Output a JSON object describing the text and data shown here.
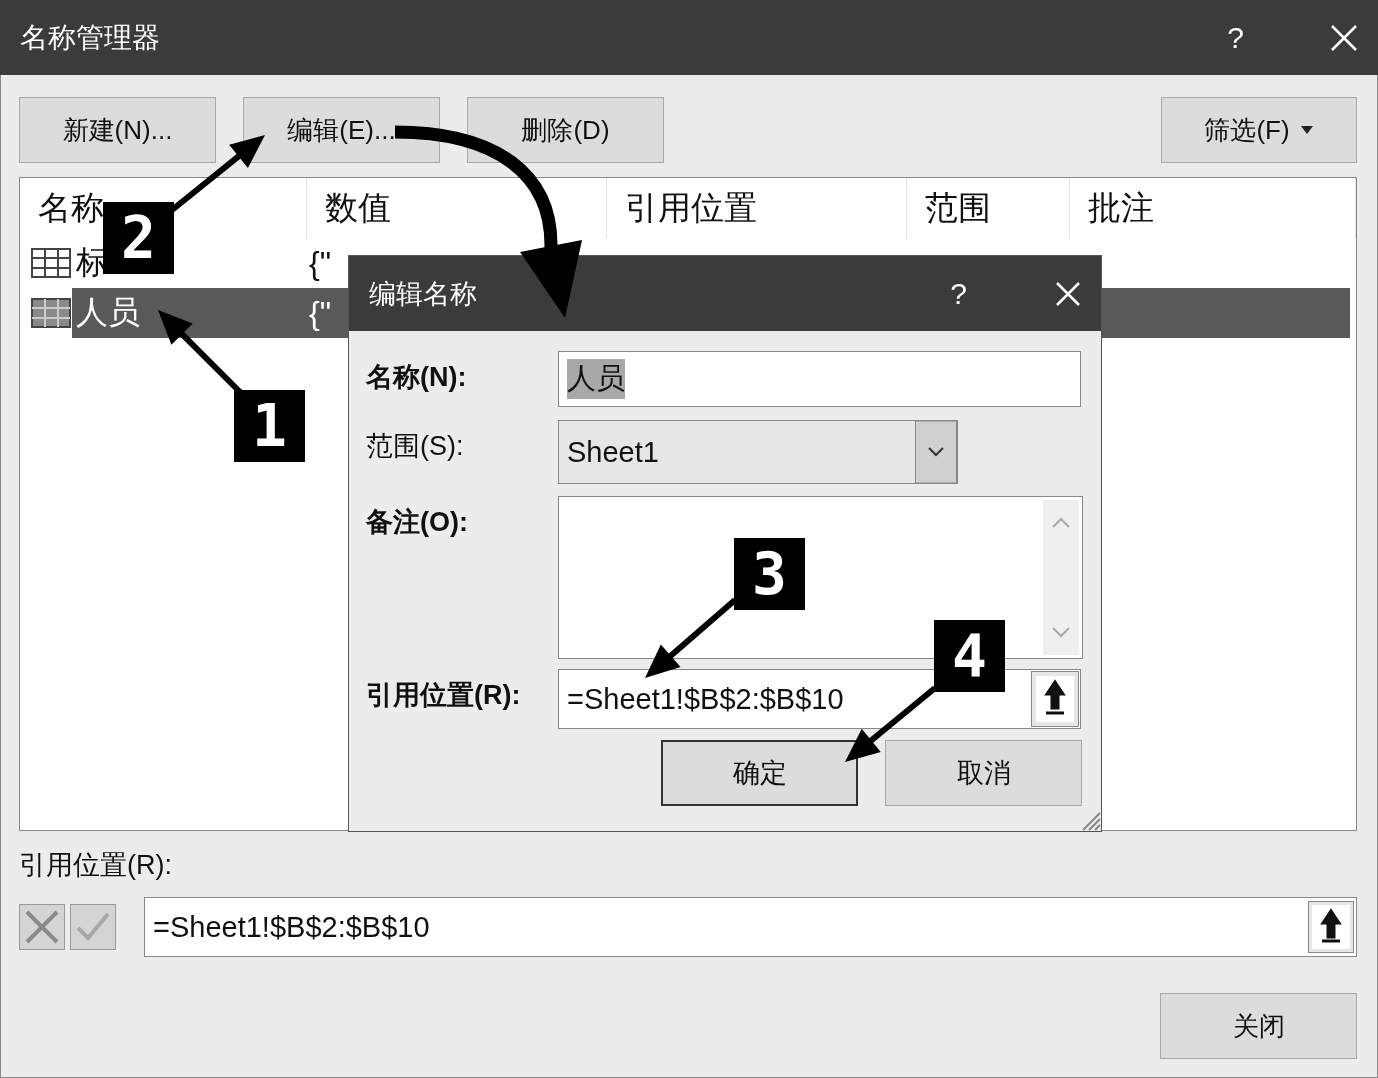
{
  "window": {
    "title": "名称管理器",
    "help": "?"
  },
  "toolbar": {
    "buttons": [
      "新建(N)...",
      "编辑(E)...",
      "删除(D)"
    ],
    "filter": "筛选(F)"
  },
  "table": {
    "columns": [
      "名称",
      "数值",
      "引用位置",
      "范围",
      "批注"
    ],
    "rows": [
      {
        "name": "标",
        "value": "{\"",
        "selected": false
      },
      {
        "name": "人员",
        "value": "{\"",
        "selected": true
      }
    ]
  },
  "refers_to": {
    "label": "引用位置(R):",
    "value": "=Sheet1!$B$2:$B$10"
  },
  "close_button": "关闭",
  "edit_dialog": {
    "title": "编辑名称",
    "help": "?",
    "name_label": "名称(N):",
    "name_value": "人员",
    "name_value_selected": true,
    "scope_label": "范围(S):",
    "scope_value": "Sheet1",
    "comment_label": "备注(O):",
    "refers_label": "引用位置(R):",
    "refers_value": "=Sheet1!$B$2:$B$10",
    "ok": "确定",
    "cancel": "取消"
  },
  "annotations": [
    {
      "label": "2"
    },
    {
      "label": "1"
    },
    {
      "label": "3"
    },
    {
      "label": "4"
    }
  ]
}
